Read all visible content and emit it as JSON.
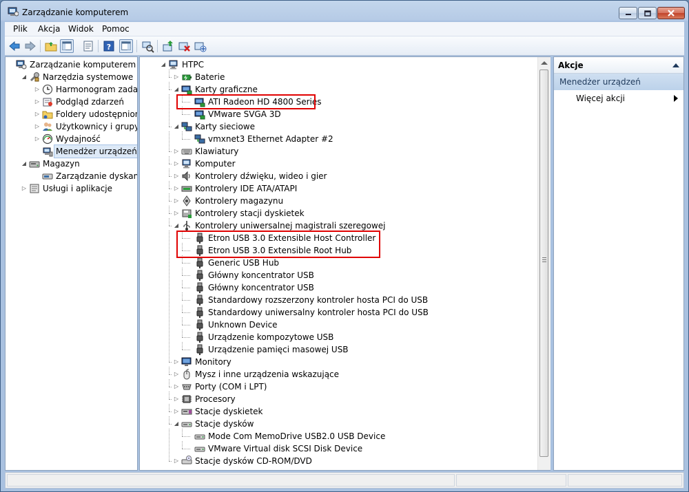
{
  "window": {
    "title": "Zarządzanie komputerem"
  },
  "menu": [
    "Plik",
    "Akcja",
    "Widok",
    "Pomoc"
  ],
  "left_tree": [
    {
      "label": "Zarządzanie komputerem (lokalne)",
      "icon": "computer-management-icon",
      "depth": 0,
      "expander": "none"
    },
    {
      "label": "Narzędzia systemowe",
      "icon": "tools-icon",
      "depth": 1,
      "expander": "open"
    },
    {
      "label": "Harmonogram zadań",
      "icon": "clock-icon",
      "depth": 2,
      "expander": "closed"
    },
    {
      "label": "Podgląd zdarzeń",
      "icon": "event-viewer-icon",
      "depth": 2,
      "expander": "closed"
    },
    {
      "label": "Foldery udostępnione",
      "icon": "shared-folder-icon",
      "depth": 2,
      "expander": "closed"
    },
    {
      "label": "Użytkownicy i grupy lokalne",
      "icon": "users-icon",
      "depth": 2,
      "expander": "closed"
    },
    {
      "label": "Wydajność",
      "icon": "performance-icon",
      "depth": 2,
      "expander": "closed"
    },
    {
      "label": "Menedżer urządzeń",
      "icon": "device-manager-icon",
      "depth": 2,
      "expander": "none",
      "selected": true
    },
    {
      "label": "Magazyn",
      "icon": "storage-icon",
      "depth": 1,
      "expander": "open"
    },
    {
      "label": "Zarządzanie dyskami",
      "icon": "disk-icon",
      "depth": 2,
      "expander": "none"
    },
    {
      "label": "Usługi i aplikacje",
      "icon": "services-icon",
      "depth": 1,
      "expander": "closed"
    }
  ],
  "device_tree": [
    {
      "label": "HTPC",
      "icon": "computer-icon",
      "depth": 0,
      "expander": "open"
    },
    {
      "label": "Baterie",
      "icon": "battery-icon",
      "depth": 1,
      "expander": "closed"
    },
    {
      "label": "Karty graficzne",
      "icon": "display-adapter-icon",
      "depth": 1,
      "expander": "open"
    },
    {
      "label": "ATI Radeon HD 4800 Series",
      "icon": "display-adapter-icon",
      "depth": 2,
      "expander": "none"
    },
    {
      "label": "VMware SVGA 3D",
      "icon": "display-adapter-icon",
      "depth": 2,
      "expander": "none"
    },
    {
      "label": "Karty sieciowe",
      "icon": "network-icon",
      "depth": 1,
      "expander": "open"
    },
    {
      "label": "vmxnet3 Ethernet Adapter #2",
      "icon": "network-icon",
      "depth": 2,
      "expander": "none"
    },
    {
      "label": "Klawiatury",
      "icon": "keyboard-icon",
      "depth": 1,
      "expander": "closed"
    },
    {
      "label": "Komputer",
      "icon": "computer-icon",
      "depth": 1,
      "expander": "closed"
    },
    {
      "label": "Kontrolery dźwięku, wideo i gier",
      "icon": "speaker-icon",
      "depth": 1,
      "expander": "closed"
    },
    {
      "label": "Kontrolery IDE ATA/ATAPI",
      "icon": "ide-icon",
      "depth": 1,
      "expander": "closed"
    },
    {
      "label": "Kontrolery magazynu",
      "icon": "storage-controller-icon",
      "depth": 1,
      "expander": "closed"
    },
    {
      "label": "Kontrolery stacji dyskietek",
      "icon": "floppy-controller-icon",
      "depth": 1,
      "expander": "closed"
    },
    {
      "label": "Kontrolery uniwersalnej magistrali szeregowej",
      "icon": "usb-icon",
      "depth": 1,
      "expander": "open"
    },
    {
      "label": "Etron USB 3.0 Extensible Host Controller",
      "icon": "usb-plug-icon",
      "depth": 2,
      "expander": "none"
    },
    {
      "label": "Etron USB 3.0 Extensible Root Hub",
      "icon": "usb-plug-icon",
      "depth": 2,
      "expander": "none"
    },
    {
      "label": "Generic USB Hub",
      "icon": "usb-plug-icon",
      "depth": 2,
      "expander": "none"
    },
    {
      "label": "Główny koncentrator USB",
      "icon": "usb-plug-icon",
      "depth": 2,
      "expander": "none"
    },
    {
      "label": "Główny koncentrator USB",
      "icon": "usb-plug-icon",
      "depth": 2,
      "expander": "none"
    },
    {
      "label": "Standardowy rozszerzony kontroler hosta PCI do USB",
      "icon": "usb-plug-icon",
      "depth": 2,
      "expander": "none"
    },
    {
      "label": "Standardowy uniwersalny kontroler hosta PCI do USB",
      "icon": "usb-plug-icon",
      "depth": 2,
      "expander": "none"
    },
    {
      "label": "Unknown Device",
      "icon": "usb-plug-icon",
      "depth": 2,
      "expander": "none"
    },
    {
      "label": "Urządzenie kompozytowe USB",
      "icon": "usb-plug-icon",
      "depth": 2,
      "expander": "none"
    },
    {
      "label": "Urządzenie pamięci masowej USB",
      "icon": "usb-plug-icon",
      "depth": 2,
      "expander": "none"
    },
    {
      "label": "Monitory",
      "icon": "monitor-icon",
      "depth": 1,
      "expander": "closed"
    },
    {
      "label": "Mysz i inne urządzenia wskazujące",
      "icon": "mouse-icon",
      "depth": 1,
      "expander": "closed"
    },
    {
      "label": "Porty (COM i LPT)",
      "icon": "port-icon",
      "depth": 1,
      "expander": "closed"
    },
    {
      "label": "Procesory",
      "icon": "processor-icon",
      "depth": 1,
      "expander": "closed"
    },
    {
      "label": "Stacje dyskietek",
      "icon": "floppy-drive-icon",
      "depth": 1,
      "expander": "closed"
    },
    {
      "label": "Stacje dysków",
      "icon": "disk-drive-icon",
      "depth": 1,
      "expander": "open"
    },
    {
      "label": "Mode Com MemoDrive USB2.0 USB Device",
      "icon": "disk-drive-icon",
      "depth": 2,
      "expander": "none"
    },
    {
      "label": "VMware Virtual disk SCSI Disk Device",
      "icon": "disk-drive-icon",
      "depth": 2,
      "expander": "none"
    },
    {
      "label": "Stacje dysków CD-ROM/DVD",
      "icon": "cdrom-icon",
      "depth": 1,
      "expander": "closed"
    }
  ],
  "highlights": [
    {
      "first": 3,
      "last": 3
    },
    {
      "first": 14,
      "last": 15
    }
  ],
  "actions": {
    "header": "Akcje",
    "section": "Menedżer urządzeń",
    "item": "Więcej akcji"
  },
  "colors": {
    "highlight": "#e00000",
    "selection": "#dde9f7"
  }
}
